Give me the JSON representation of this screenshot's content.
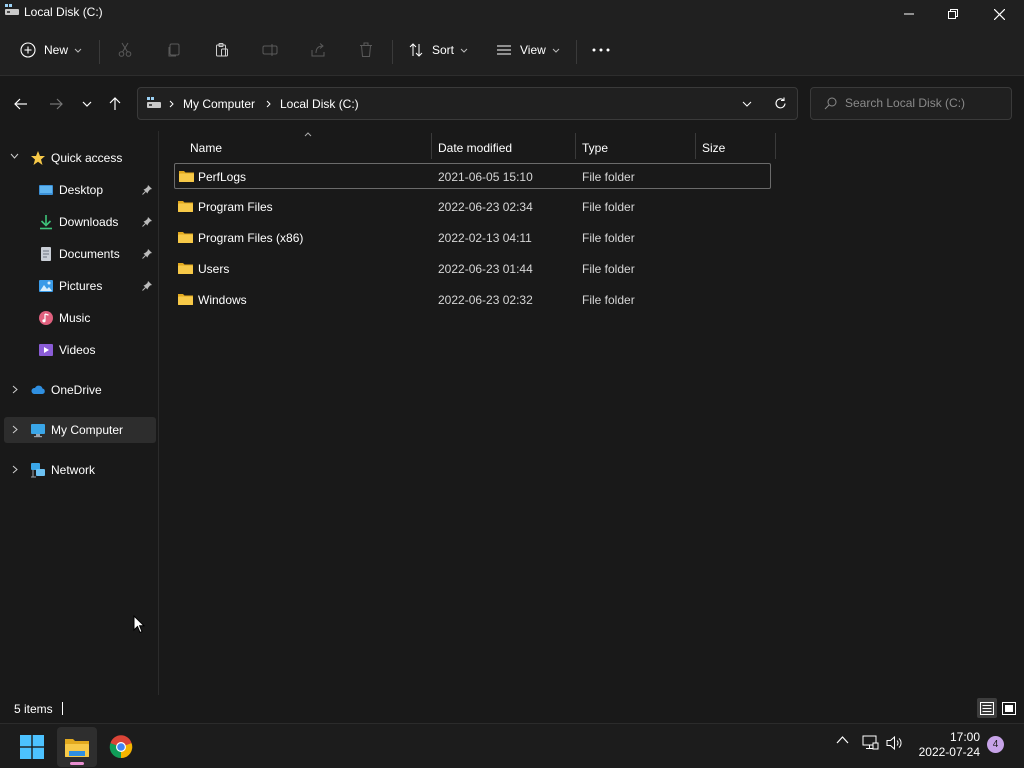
{
  "window": {
    "title": "Local Disk (C:)"
  },
  "toolbar": {
    "new_label": "New",
    "sort_label": "Sort",
    "view_label": "View"
  },
  "address": {
    "crumbs": [
      "My Computer",
      "Local Disk (C:)"
    ],
    "search_placeholder": "Search Local Disk (C:)"
  },
  "nav": {
    "quick_access": "Quick access",
    "items": [
      {
        "label": "Desktop",
        "icon": "desktop-icon",
        "pinned": true
      },
      {
        "label": "Downloads",
        "icon": "downloads-icon",
        "pinned": true
      },
      {
        "label": "Documents",
        "icon": "documents-icon",
        "pinned": true
      },
      {
        "label": "Pictures",
        "icon": "pictures-icon",
        "pinned": true
      },
      {
        "label": "Music",
        "icon": "music-icon",
        "pinned": false
      },
      {
        "label": "Videos",
        "icon": "videos-icon",
        "pinned": false
      }
    ],
    "onedrive": "OneDrive",
    "my_computer": "My Computer",
    "network": "Network"
  },
  "columns": {
    "name": "Name",
    "date": "Date modified",
    "type": "Type",
    "size": "Size"
  },
  "files": [
    {
      "name": "PerfLogs",
      "date": "2021-06-05 15:10",
      "type": "File folder",
      "size": ""
    },
    {
      "name": "Program Files",
      "date": "2022-06-23 02:34",
      "type": "File folder",
      "size": ""
    },
    {
      "name": "Program Files (x86)",
      "date": "2022-02-13 04:11",
      "type": "File folder",
      "size": ""
    },
    {
      "name": "Users",
      "date": "2022-06-23 01:44",
      "type": "File folder",
      "size": ""
    },
    {
      "name": "Windows",
      "date": "2022-06-23 02:32",
      "type": "File folder",
      "size": ""
    }
  ],
  "status": {
    "item_count": "5 items"
  },
  "taskbar": {
    "time": "17:00",
    "date": "2022-07-24",
    "notification_count": "4"
  },
  "colors": {
    "folder": "#f7c948",
    "accent": "#60cdff",
    "background": "#191919"
  }
}
